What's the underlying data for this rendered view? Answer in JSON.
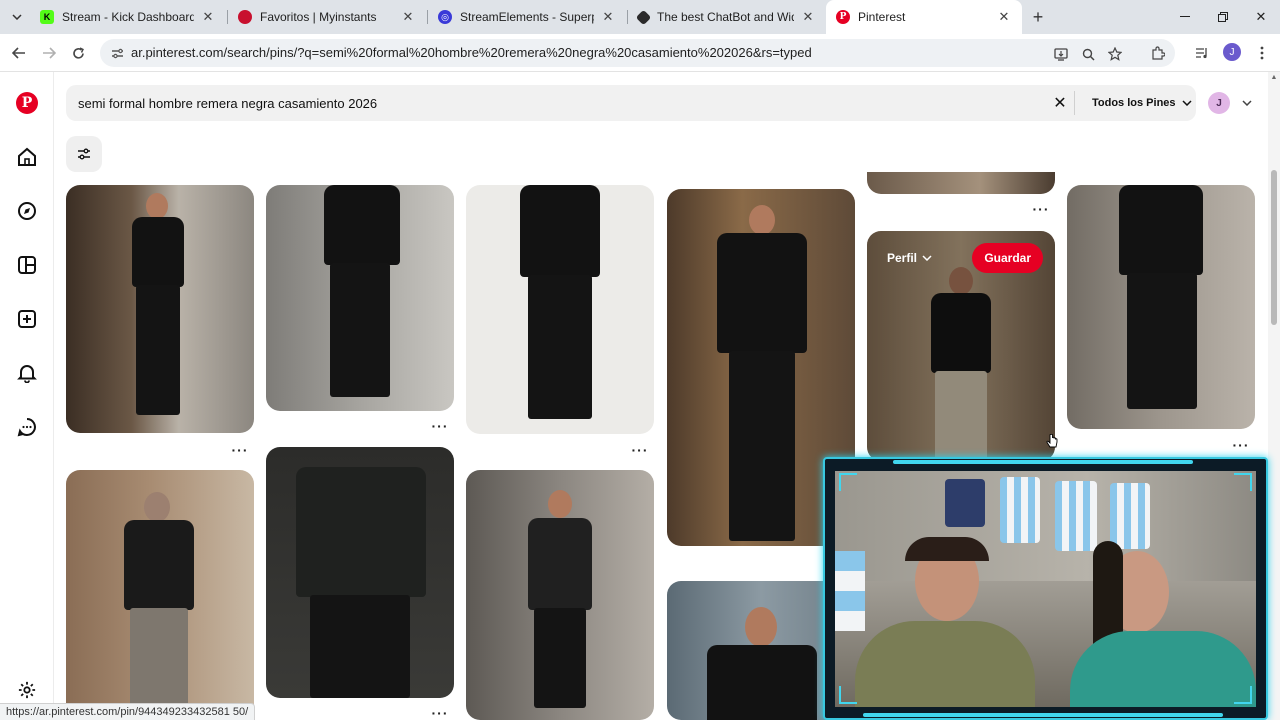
{
  "browser": {
    "tabs": [
      {
        "title": "Stream - Kick Dashboard",
        "active": false
      },
      {
        "title": "Favoritos | Myinstants",
        "active": false
      },
      {
        "title": "StreamElements - Superposicio",
        "active": false
      },
      {
        "title": "The best ChatBot and Widgets",
        "active": false
      },
      {
        "title": "Pinterest",
        "active": true
      }
    ],
    "url": "ar.pinterest.com/search/pins/?q=semi%20formal%20hombre%20remera%20negra%20casamiento%202026&rs=typed",
    "status_url": "https://ar.pinterest.com/pin/944349233432581 50/"
  },
  "search": {
    "query": "semi formal hombre remera negra casamiento 2026",
    "scope": "Todos los Pines"
  },
  "account": {
    "initial": "J"
  },
  "hover_pin": {
    "perfil": "Perfil",
    "save": "Guardar"
  },
  "colors": {
    "brand": "#e60023",
    "cam_border": "#38c8e0"
  }
}
